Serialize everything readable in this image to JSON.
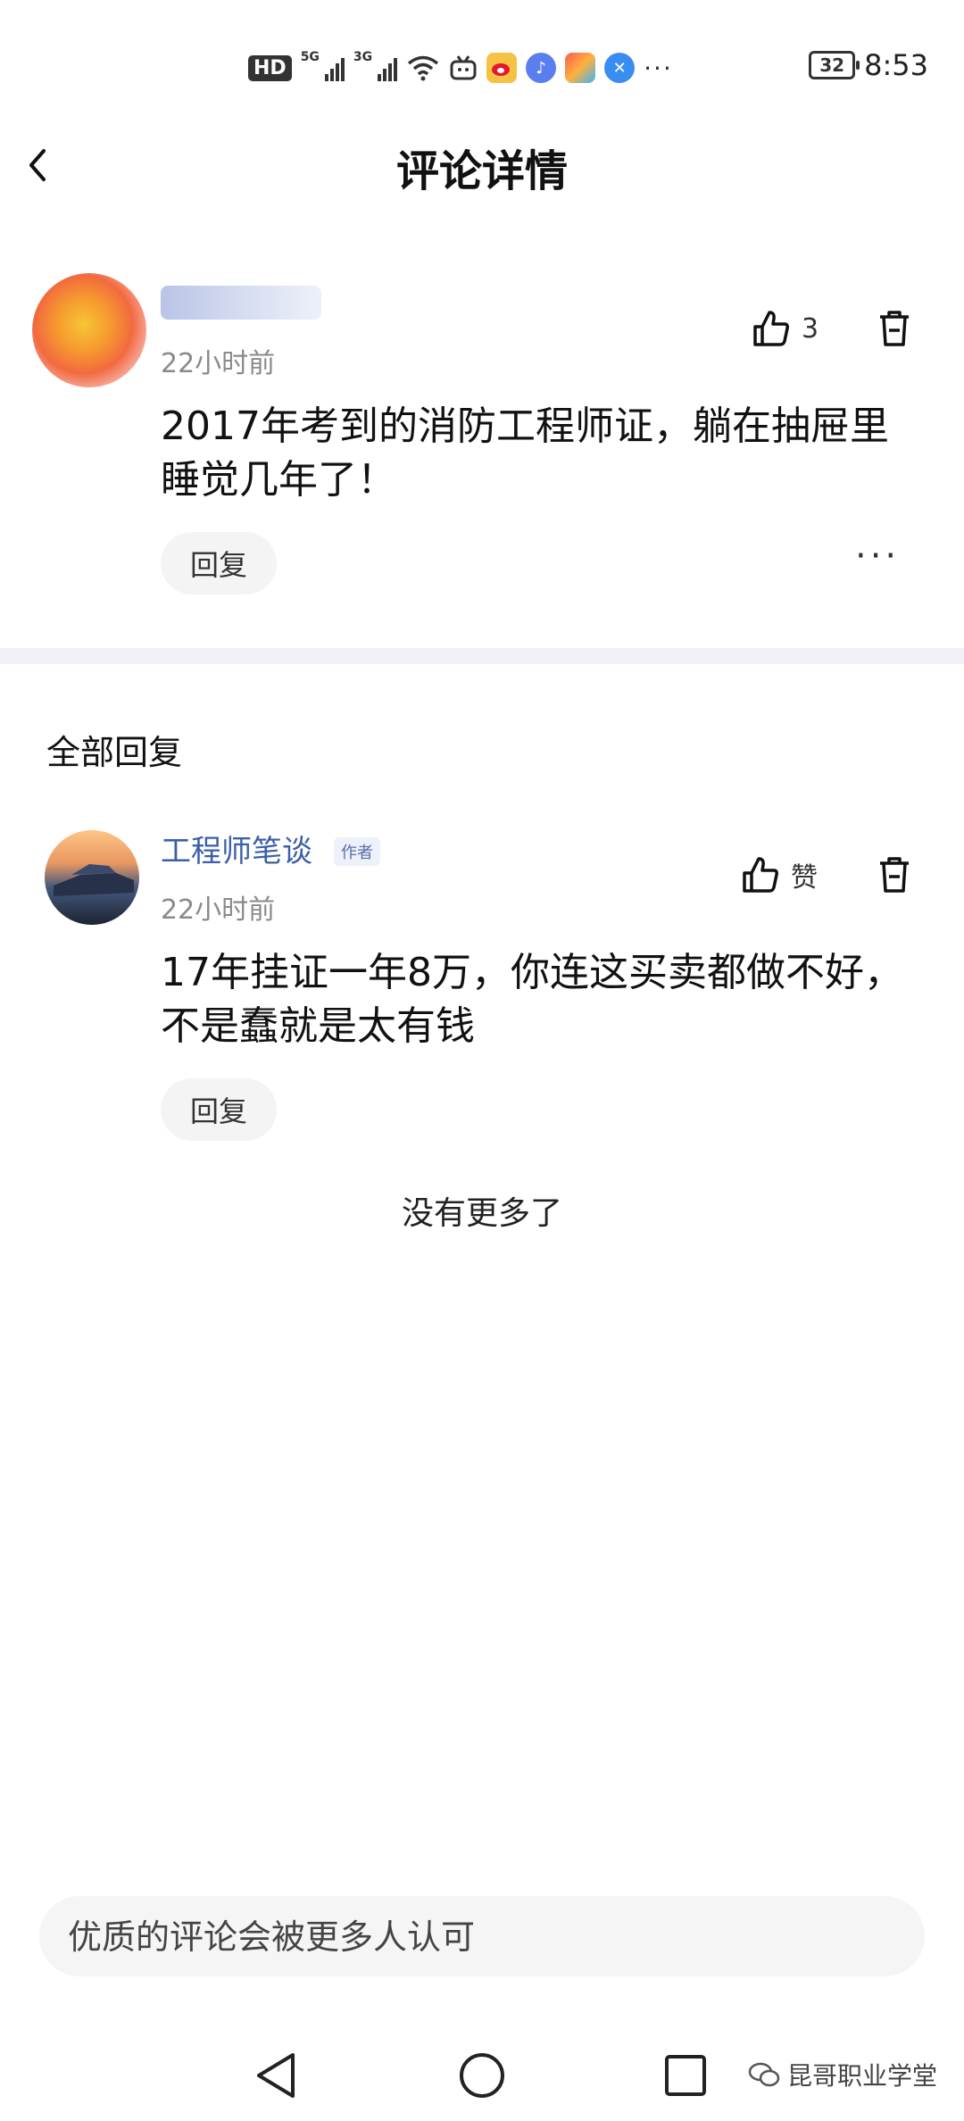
{
  "status_bar": {
    "network_hd": "HD",
    "net1": "5G",
    "net2": "3G",
    "battery": "32",
    "time": "8:53",
    "icons": [
      "hd-icon",
      "signal-5g-icon",
      "signal-3g-icon",
      "wifi-icon",
      "bilibili-icon",
      "weibo-icon",
      "music-icon",
      "app-icon",
      "browser-icon",
      "more-icon"
    ]
  },
  "header": {
    "back_icon": "chevron-left-icon",
    "title": "评论详情"
  },
  "main_comment": {
    "time": "22小时前",
    "like_count": "3",
    "text": "2017年考到的消防工程师证，躺在抽屉里睡觉几年了！",
    "reply_label": "回复",
    "more_label": "···"
  },
  "replies_section": {
    "title": "全部回复",
    "items": [
      {
        "author": "工程师笔谈",
        "author_tag": "作者",
        "time": "22小时前",
        "like_label": "赞",
        "text": "17年挂证一年8万，你连这买卖都做不好，不是蠢就是太有钱",
        "reply_label": "回复"
      }
    ],
    "end_text": "没有更多了"
  },
  "input": {
    "placeholder": "优质的评论会被更多人认可"
  },
  "watermark": {
    "text": "昆哥职业学堂"
  },
  "colors": {
    "author_blue": "#3b5fa8",
    "divider": "#f1f2f6",
    "muted": "#8a8a8a"
  }
}
